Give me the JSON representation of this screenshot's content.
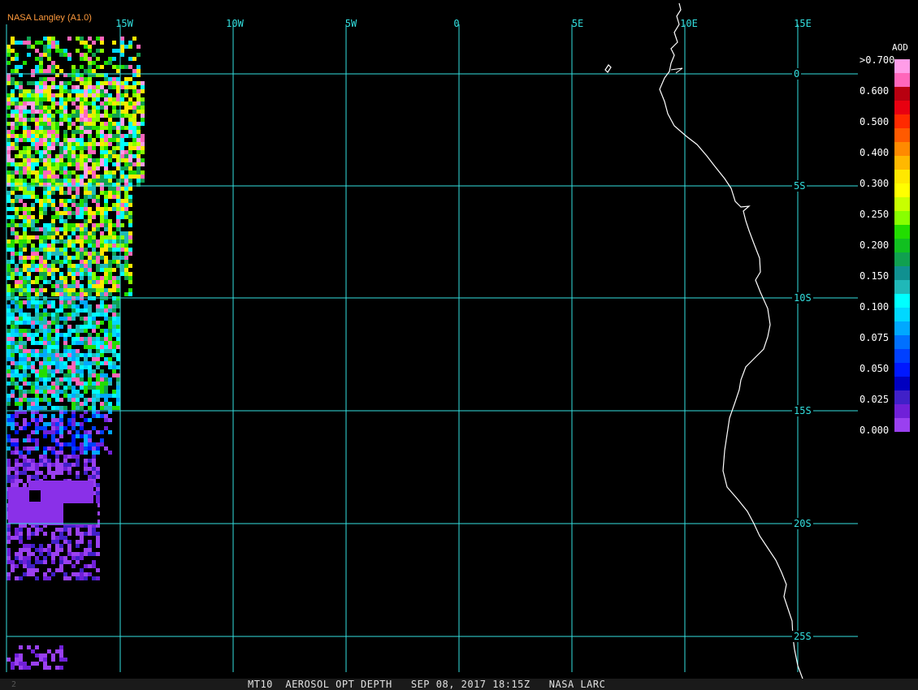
{
  "credit": "NASA Langley (A1.0)",
  "footer_text": "MT10  AEROSOL OPT DEPTH   SEP 08, 2017 18:15Z   NASA LARC",
  "corner_mark": "2",
  "lon_labels": [
    "15W",
    "10W",
    "5W",
    "0",
    "5E",
    "10E",
    "15E"
  ],
  "lat_labels": [
    "0",
    "5S",
    "10S",
    "15S",
    "20S",
    "25S"
  ],
  "legend": {
    "title": "AOD",
    "labels": [
      ">0.700",
      "0.600",
      "0.500",
      "0.400",
      "0.300",
      "0.250",
      "0.200",
      "0.150",
      "0.100",
      "0.075",
      "0.050",
      "0.025",
      "0.000"
    ],
    "colors": [
      "#ff9de8",
      "#ff66bb",
      "#b80010",
      "#e80010",
      "#ff2a00",
      "#ff5a00",
      "#ff8a00",
      "#ffb800",
      "#ffe800",
      "#ffff00",
      "#c8ff00",
      "#88ff00",
      "#22dd00",
      "#11c020",
      "#10a050",
      "#109090",
      "#20b8b8",
      "#00ffff",
      "#00d8ff",
      "#00a8ff",
      "#0070ff",
      "#0040ff",
      "#0018ff",
      "#0000c0",
      "#4020c8",
      "#7020d8",
      "#9a40f0"
    ]
  },
  "colors": {
    "grid": "#33e0e0",
    "coast": "#ffffff",
    "background": "#000000",
    "credit": "#ff9a3c"
  }
}
